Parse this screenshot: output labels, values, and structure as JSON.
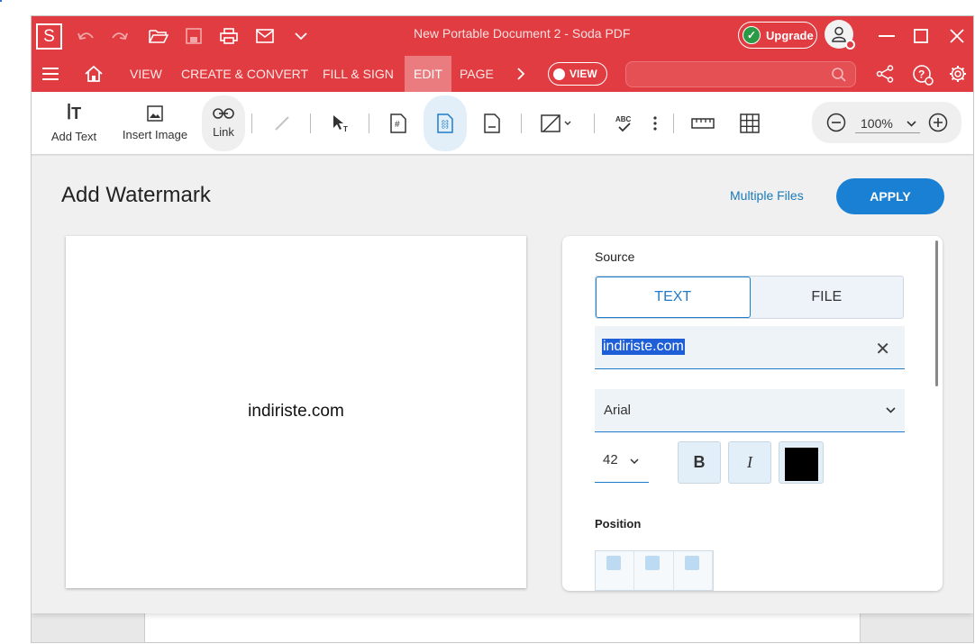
{
  "window": {
    "title": "New Portable Document 2  -  Soda PDF",
    "logo_letter": "S",
    "upgrade_label": "Upgrade"
  },
  "menu": {
    "items": [
      "VIEW",
      "CREATE & CONVERT",
      "FILL & SIGN",
      "EDIT",
      "PAGE"
    ],
    "active": "EDIT",
    "view_toggle_label": "VIEW",
    "search_placeholder": ""
  },
  "toolbar": {
    "add_text_label": "Add Text",
    "insert_image_label": "Insert Image",
    "link_label": "Link",
    "zoom_value": "100%"
  },
  "dialog": {
    "title": "Add Watermark",
    "multiple_files_label": "Multiple Files",
    "apply_label": "APPLY",
    "preview_text": "indiriste.com",
    "source_label": "Source",
    "source_tabs": [
      "TEXT",
      "FILE"
    ],
    "source_selected": "TEXT",
    "text_value": "indiriste.com",
    "font_value": "Arial",
    "size_value": "42",
    "bold_label": "B",
    "italic_label": "I",
    "color": "#000000",
    "position_label": "Position"
  },
  "colors": {
    "brand_red": "#e03c41",
    "accent_blue": "#1a80d4"
  }
}
